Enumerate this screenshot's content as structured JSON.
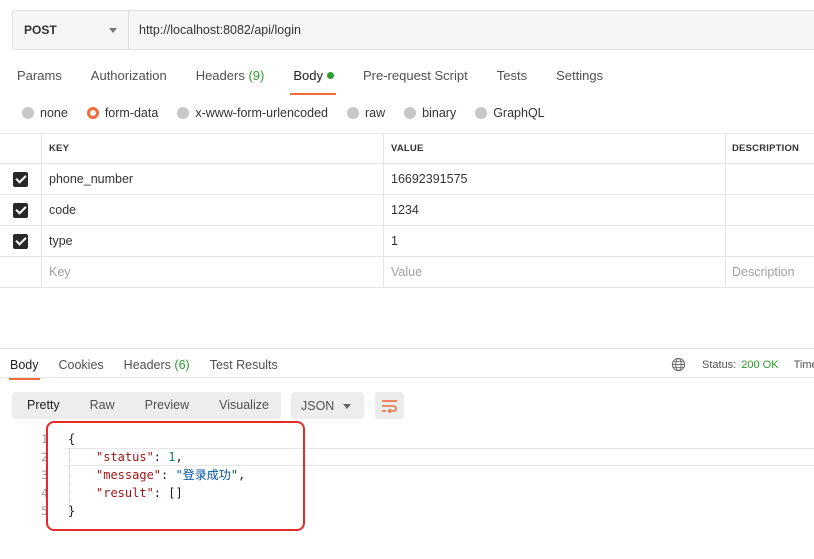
{
  "request": {
    "method": "POST",
    "url": "http://localhost:8082/api/login"
  },
  "request_tabs": [
    {
      "label": "Params"
    },
    {
      "label": "Authorization"
    },
    {
      "label": "Headers",
      "count": "(9)"
    },
    {
      "label": "Body",
      "active": true
    },
    {
      "label": "Pre-request Script"
    },
    {
      "label": "Tests"
    },
    {
      "label": "Settings"
    }
  ],
  "body_types": [
    {
      "label": "none",
      "selected": false
    },
    {
      "label": "form-data",
      "selected": true
    },
    {
      "label": "x-www-form-urlencoded",
      "selected": false
    },
    {
      "label": "raw",
      "selected": false
    },
    {
      "label": "binary",
      "selected": false
    },
    {
      "label": "GraphQL",
      "selected": false
    }
  ],
  "params_table": {
    "headers": {
      "key": "KEY",
      "value": "VALUE",
      "description": "DESCRIPTION"
    },
    "rows": [
      {
        "checked": true,
        "key": "phone_number",
        "value": "16692391575",
        "description": ""
      },
      {
        "checked": true,
        "key": "code",
        "value": "1234",
        "description": ""
      },
      {
        "checked": true,
        "key": "type",
        "value": "1",
        "description": ""
      }
    ],
    "placeholders": {
      "key": "Key",
      "value": "Value",
      "description": "Description"
    }
  },
  "response_tabs": [
    {
      "label": "Body",
      "active": true
    },
    {
      "label": "Cookies"
    },
    {
      "label": "Headers",
      "count": "(6)"
    },
    {
      "label": "Test Results"
    }
  ],
  "status": {
    "label": "Status:",
    "value": "200 OK",
    "time_label": "Time"
  },
  "view_modes": [
    "Pretty",
    "Raw",
    "Preview",
    "Visualize"
  ],
  "active_view": "Pretty",
  "format": "JSON",
  "response_body": {
    "line_numbers": [
      "1",
      "2",
      "3",
      "4",
      "5"
    ],
    "open_brace": "{",
    "close_brace": "}",
    "status_key": "\"status\"",
    "status_value": "1",
    "message_key": "\"message\"",
    "message_value": "\"登录成功\"",
    "result_key": "\"result\"",
    "result_value": "[]"
  },
  "colors": {
    "accent": "#f26b3a",
    "success": "#2d9d2d",
    "annotation": "#e32b2b"
  }
}
